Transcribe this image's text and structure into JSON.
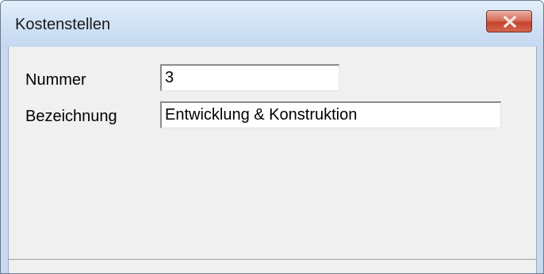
{
  "window": {
    "title": "Kostenstellen",
    "close_icon": "close-x-icon"
  },
  "form": {
    "nummer": {
      "label": "Nummer",
      "value": "3"
    },
    "bezeichnung": {
      "label": "Bezeichnung",
      "value": "Entwicklung & Konstruktion"
    }
  }
}
